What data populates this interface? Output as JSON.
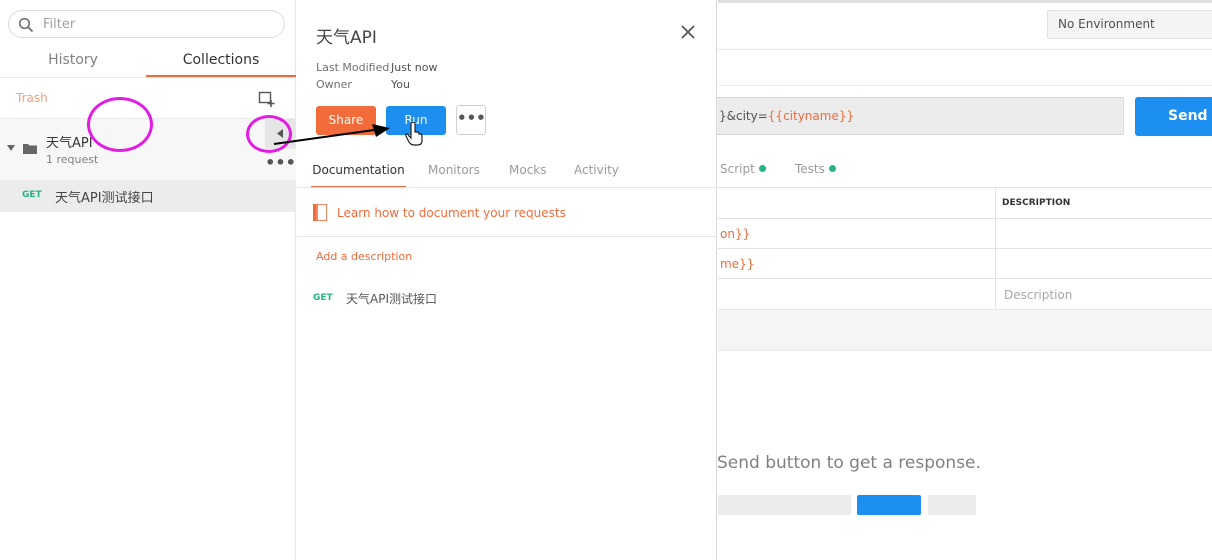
{
  "sidebar": {
    "filter_placeholder": "Filter",
    "tabs": {
      "history": "History",
      "collections": "Collections"
    },
    "trash_label": "Trash",
    "collection": {
      "name": "天气API",
      "count": "1 request"
    },
    "request": {
      "method": "GET",
      "name": "天气API测试接口"
    },
    "more_label": "•••"
  },
  "detail": {
    "title": "天气API",
    "meta": {
      "modified_label": "Last Modified",
      "modified_value": "Just now",
      "owner_label": "Owner",
      "owner_value": "You"
    },
    "buttons": {
      "share": "Share",
      "run": "Run",
      "more": "•••"
    },
    "tabs": {
      "documentation": "Documentation",
      "monitors": "Monitors",
      "mocks": "Mocks",
      "activity": "Activity"
    },
    "learn_link": "Learn how to document your requests",
    "add_description": "Add a description",
    "request": {
      "method": "GET",
      "name": "天气API测试接口"
    }
  },
  "background": {
    "environment": "No Environment",
    "url_prefix": "}&city=",
    "url_var": "{{cityname}}",
    "send_label": "Send",
    "tabs": {
      "script": "Script",
      "tests": "Tests"
    },
    "table": {
      "desc_header": "DESCRIPTION",
      "rows": [
        "on}}",
        "me}}"
      ],
      "desc_placeholder": "Description"
    },
    "hint": "Send button to get a response."
  },
  "colors": {
    "accent_orange": "#f26b3a",
    "accent_blue": "#1c8ff0",
    "method_green": "#26b47f",
    "annotation_magenta": "#e21ce2"
  }
}
